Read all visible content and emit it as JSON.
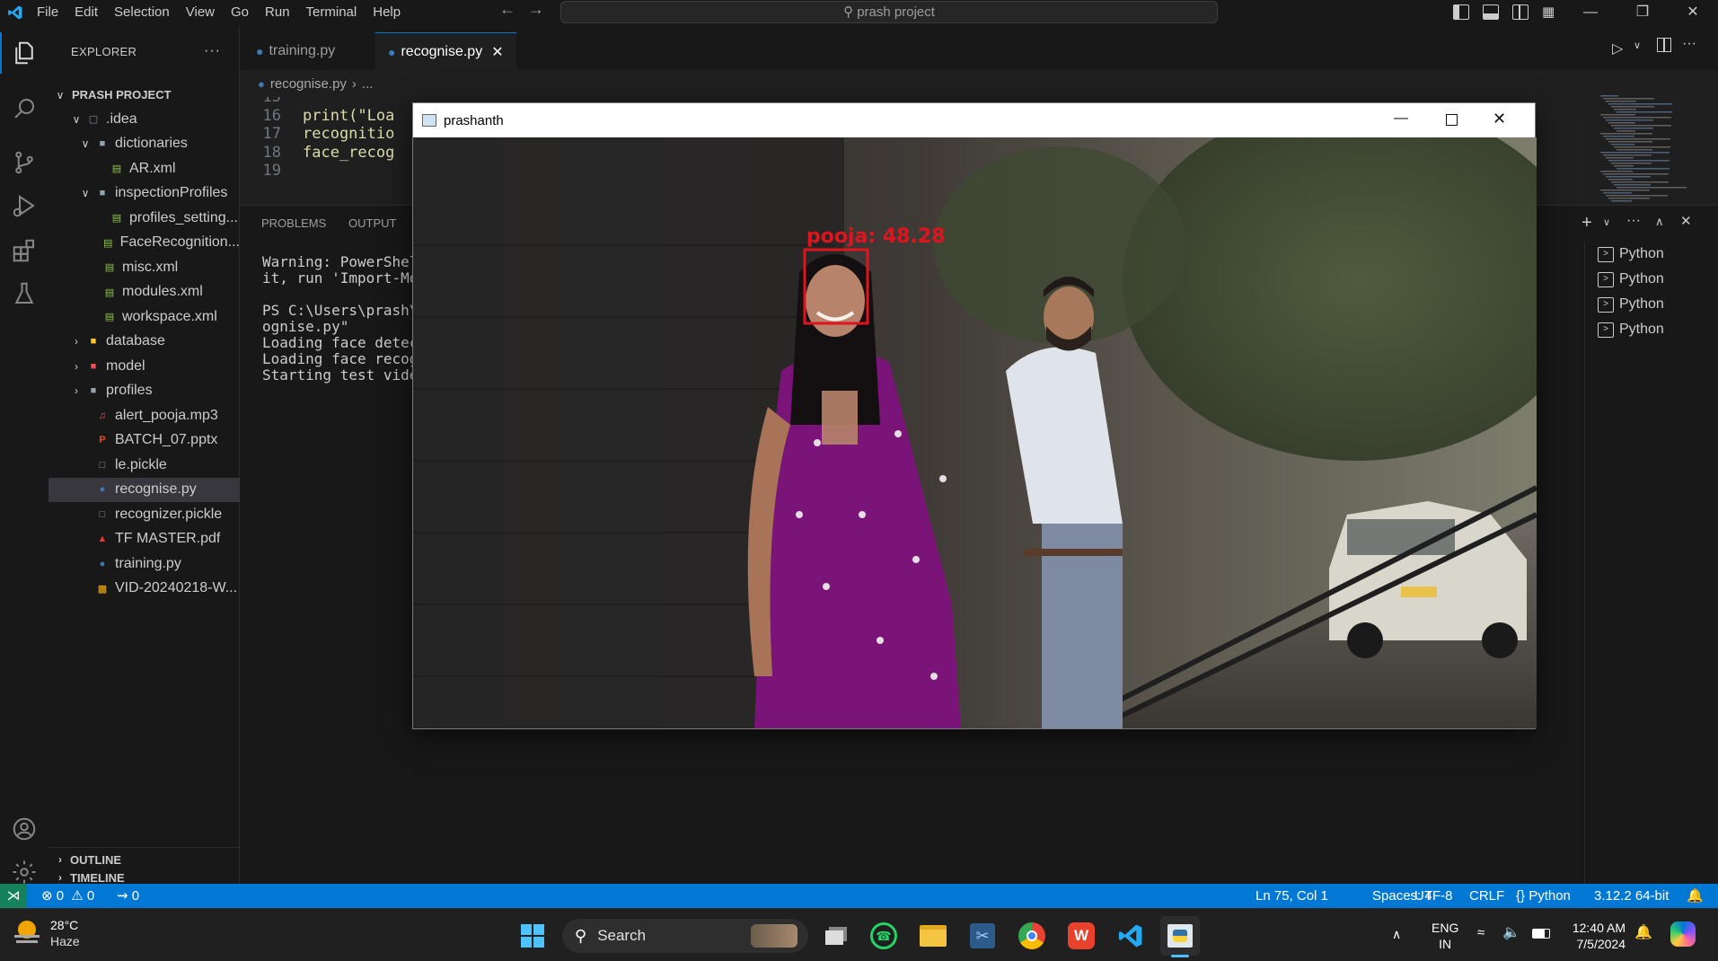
{
  "titlebar": {
    "menu": [
      "File",
      "Edit",
      "Selection",
      "View",
      "Go",
      "Run",
      "Terminal",
      "Help"
    ],
    "search_text": "prash project"
  },
  "explorer": {
    "title": "EXPLORER",
    "project": "PRASH PROJECT",
    "items": [
      {
        "label": ".idea",
        "icon": "folder-idea-icon"
      },
      {
        "label": "dictionaries",
        "icon": "folder-icon"
      },
      {
        "label": "AR.xml",
        "icon": "xml-file-icon"
      },
      {
        "label": "inspectionProfiles",
        "icon": "folder-icon"
      },
      {
        "label": "profiles_setting...",
        "icon": "xml-file-icon"
      },
      {
        "label": "FaceRecognition...",
        "icon": "xml-file-icon"
      },
      {
        "label": "misc.xml",
        "icon": "xml-file-icon"
      },
      {
        "label": "modules.xml",
        "icon": "xml-file-icon"
      },
      {
        "label": "workspace.xml",
        "icon": "xml-file-icon"
      },
      {
        "label": "database",
        "icon": "folder-database-icon"
      },
      {
        "label": "model",
        "icon": "folder-model-icon"
      },
      {
        "label": "profiles",
        "icon": "folder-icon"
      },
      {
        "label": "alert_pooja.mp3",
        "icon": "audio-file-icon"
      },
      {
        "label": "BATCH_07.pptx",
        "icon": "pptx-file-icon"
      },
      {
        "label": "le.pickle",
        "icon": "file-icon"
      },
      {
        "label": "recognise.py",
        "icon": "python-file-icon"
      },
      {
        "label": "recognizer.pickle",
        "icon": "file-icon"
      },
      {
        "label": "TF MASTER.pdf",
        "icon": "pdf-file-icon"
      },
      {
        "label": "training.py",
        "icon": "python-file-icon"
      },
      {
        "label": "VID-20240218-W...",
        "icon": "video-file-icon"
      }
    ],
    "outline": "OUTLINE",
    "timeline": "TIMELINE"
  },
  "tabs": [
    {
      "label": "training.py"
    },
    {
      "label": "recognise.py"
    }
  ],
  "breadcrumb": {
    "file": "recognise.py",
    "rest": "..."
  },
  "code": [
    {
      "n": "15",
      "text": ""
    },
    {
      "n": "16",
      "text": "print(\"Loa"
    },
    {
      "n": "17",
      "text": "recognitio"
    },
    {
      "n": "18",
      "text": "face_recog"
    },
    {
      "n": "19",
      "text": ""
    }
  ],
  "panel": {
    "tabs": [
      "PROBLEMS",
      "OUTPUT"
    ],
    "terminal_lines": [
      "Warning: PowerShell",
      "it, run 'Import-Mod",
      "",
      "PS C:\\Users\\prash\\D",
      "ognise.py\"",
      "Loading face detect",
      "Loading face recogn",
      "Starting test video"
    ],
    "terminals": [
      "Python",
      "Python",
      "Python",
      "Python"
    ]
  },
  "cv_window": {
    "title": "prashanth",
    "detection_label": "pooja: 48.28",
    "box_color": "#e0141e"
  },
  "statusbar": {
    "errors": "0",
    "warnings": "0",
    "ports": "0",
    "position": "Ln 75, Col 1",
    "spaces": "Spaces: 4",
    "encoding": "UTF-8",
    "eol": "CRLF",
    "language": "Python",
    "interpreter": "3.12.2 64-bit"
  },
  "taskbar": {
    "temp": "28°C",
    "weather": "Haze",
    "search": "Search",
    "lang_top": "ENG",
    "lang_bottom": "IN",
    "time": "12:40 AM",
    "date": "7/5/2024"
  },
  "colors": {
    "accent": "#0078d4",
    "editor_bg": "#1f1f1f",
    "sidebar_bg": "#181818"
  }
}
